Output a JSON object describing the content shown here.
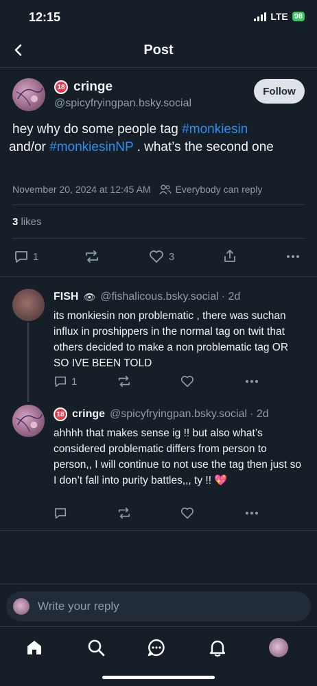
{
  "status_bar": {
    "time": "12:15",
    "network": "LTE",
    "battery": "98"
  },
  "header": {
    "title": "Post"
  },
  "post": {
    "display_name": "cringe",
    "handle": "@spicyfryingpan.bsky.social",
    "follow_label": "Follow",
    "text_part1": "hey why do some people tag ",
    "tag1": "#monkiesin",
    "text_part2": " and/or ",
    "tag2": "#monkiesinNP",
    "text_part3": " . what’s the second one",
    "timestamp": "November 20, 2024 at 12:45 AM",
    "reply_setting": "Everybody can reply",
    "likes_count": "3",
    "likes_label": " likes",
    "reply_count": "1",
    "like_count": "3"
  },
  "replies": [
    {
      "display_name": "FISH",
      "emoji": "👁",
      "handle": "@fishalicous.bsky.social",
      "age": "· 2d",
      "text": "its monkiesin non problematic , there was suchan influx in proshippers in the normal tag on twit that others decided to make a non problematic tag OR SO IVE BEEN TOLD",
      "reply_count": "1"
    },
    {
      "display_name": "cringe",
      "handle": "@spicyfryingpan.bsky.social",
      "age": "· 2d",
      "text": "ahhhh that makes sense ig !! but also what’s considered problematic differs from person to person,, I will continue to not use the tag then just so I don’t fall into purity battles,,, ty !! 💖"
    }
  ],
  "compose": {
    "placeholder": "Write your reply"
  },
  "colors": {
    "background": "#161e27",
    "accent": "#2f8ff0",
    "muted": "#8f9cab"
  }
}
